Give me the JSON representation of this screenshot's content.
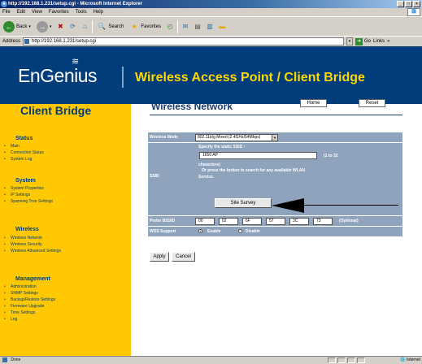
{
  "window": {
    "title": "http://192.168.1.231/setup.cgi - Microsoft Internet Explorer"
  },
  "menubar": [
    "File",
    "Edit",
    "View",
    "Favorites",
    "Tools",
    "Help"
  ],
  "toolbar": {
    "back": "Back",
    "search": "Search",
    "favorites": "Favorites"
  },
  "address": {
    "label": "Address",
    "value": "http://192.168.1.231/setup.cgi",
    "go": "Go",
    "links": "Links"
  },
  "banner": {
    "logo": "EnGenius",
    "title": "Wireless Access Point / Client Bridge"
  },
  "sidebar": {
    "title": "Client Bridge",
    "sections": [
      {
        "heading": "Status",
        "items": [
          "Main",
          "Connection Status",
          "System Log"
        ]
      },
      {
        "heading": "System",
        "items": [
          "System Properties",
          "IP Settings",
          "Spanning Tree Settings"
        ]
      },
      {
        "heading": "Wireless",
        "items": [
          "Wireless Network",
          "Wireless Security",
          "Wireless Advanced Settings"
        ]
      },
      {
        "heading": "Management",
        "items": [
          "Administration",
          "SNMP Settings",
          "Backup/Restore Settings",
          "Firmware Upgrade",
          "Time Settings",
          "Log"
        ]
      }
    ]
  },
  "main": {
    "title": "Wireless Network",
    "home_button": "Home",
    "reset_button": "Reset"
  },
  "form": {
    "mode_label": "Wireless Mode",
    "mode_value": "802.11b/g Mixed (2.4GHz/54Mbps)",
    "ssid_label": "SSID",
    "ssid_heading": "Specify the static SSID :",
    "ssid_value": "1650 AP",
    "ssid_hint": "(1 to 32",
    "ssid_hint2": "characters)",
    "ssid_or": "Or press the button to search for any available WLAN",
    "ssid_service": "Service.",
    "site_survey": "Site Survey",
    "bssid_label": "Prefer BSSID",
    "bssid_values": [
      "00",
      "02",
      "6F",
      "57",
      "3C",
      "73"
    ],
    "bssid_optional": "(Optional)",
    "wds_label": "WDS Support",
    "wds_enable": "Enable",
    "wds_disable": "Disable",
    "apply": "Apply",
    "cancel": "Cancel"
  },
  "status": {
    "text": "Done",
    "zone": "Internet"
  }
}
